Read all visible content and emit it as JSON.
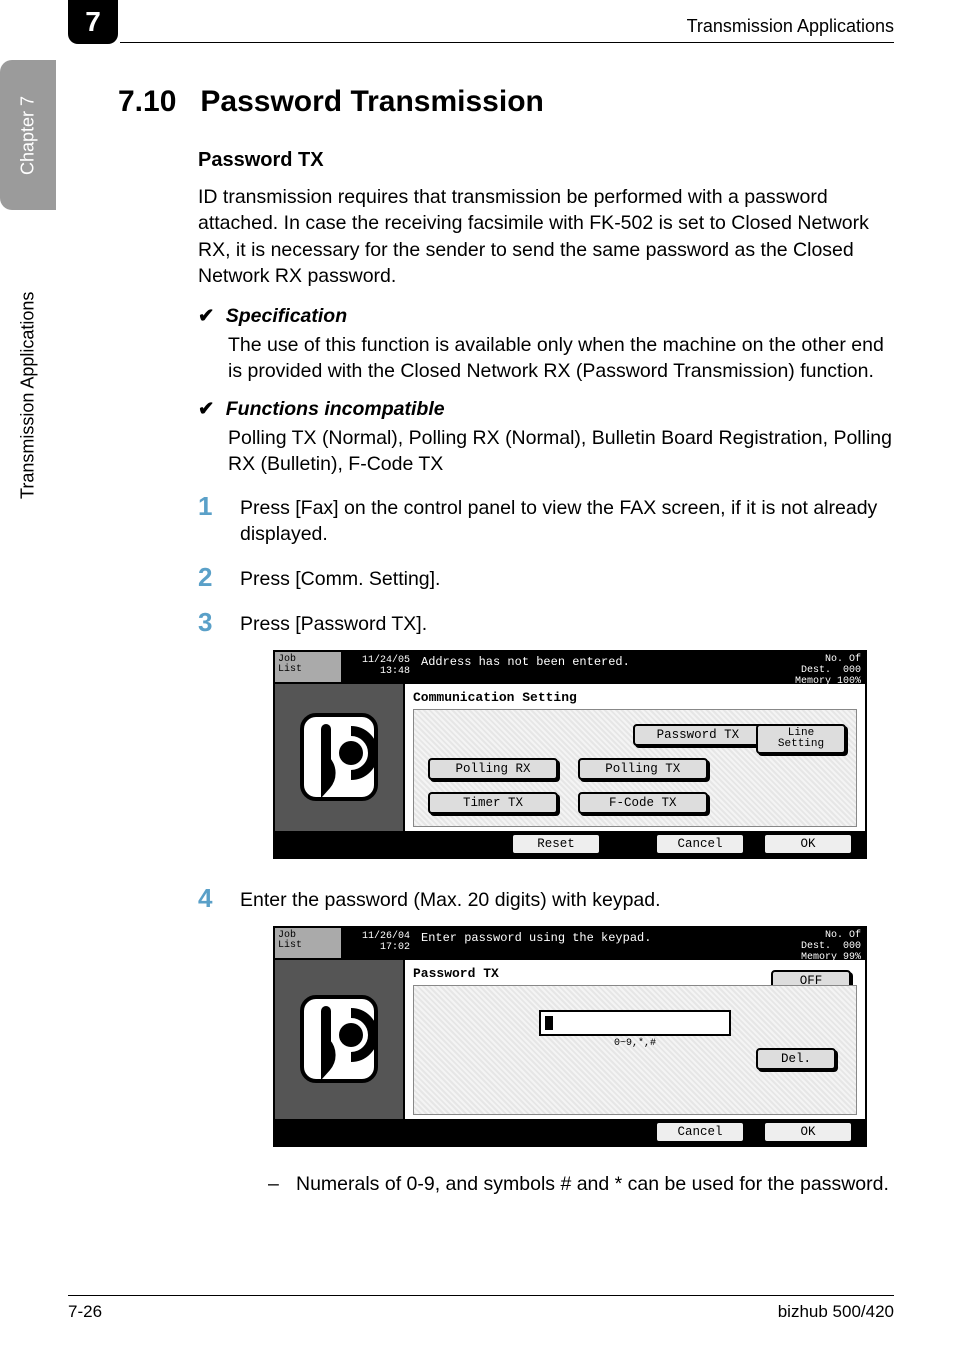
{
  "page": {
    "chapter_tab": "7",
    "side_chapter": "Chapter 7",
    "side_section": "Transmission Applications",
    "header_right": "Transmission Applications",
    "footer_left": "7-26",
    "footer_right": "bizhub 500/420"
  },
  "heading": {
    "number": "7.10",
    "title": "Password Transmission"
  },
  "subhead": "Password TX",
  "intro": "ID transmission requires that transmission be performed with a password attached. In case the receiving facsimile with FK-502 is set to Closed Network RX, it is necessary for the sender to send the same password as the Closed Network RX password.",
  "checks": [
    {
      "title": "Specification",
      "body": "The use of this function is available only when the machine on the other end is provided with the Closed Network RX (Password Transmission) function."
    },
    {
      "title": "Functions incompatible",
      "body": "Polling TX (Normal), Polling RX (Normal), Bulletin Board Registration, Polling RX (Bulletin), F-Code TX"
    }
  ],
  "steps": [
    {
      "n": "1",
      "text": "Press [Fax] on the control panel to view the FAX screen, if it is not already displayed."
    },
    {
      "n": "2",
      "text": "Press [Comm. Setting]."
    },
    {
      "n": "3",
      "text": "Press [Password TX]."
    },
    {
      "n": "4",
      "text": "Enter the password (Max. 20 digits) with keypad."
    }
  ],
  "note_after_4": "Numerals of 0-9, and symbols # and * can be used for the password.",
  "lcd1": {
    "joblist": "Job\nList",
    "datetime": "11/24/05\n13:48",
    "message": "Address has not been entered.",
    "dest_label": "No. Of\nDest.",
    "dest_count": "000",
    "memory": "Memory 100%",
    "heading": "Communication Setting",
    "buttons": {
      "password_tx": "Password TX",
      "line_setting": "Line\nSetting",
      "polling_rx": "Polling RX",
      "polling_tx": "Polling TX",
      "timer_tx": "Timer TX",
      "fcode_tx": "F-Code TX",
      "reset": "Reset",
      "cancel": "Cancel",
      "ok": "OK"
    }
  },
  "lcd2": {
    "joblist": "Job\nList",
    "datetime": "11/26/04\n17:02",
    "message": "Enter password using the keypad.",
    "dest_label": "No. Of\nDest.",
    "dest_count": "000",
    "memory": "Memory  99%",
    "heading": "Password TX",
    "hint": "0~9,*,#",
    "buttons": {
      "off": "OFF",
      "del": "Del.",
      "cancel": "Cancel",
      "ok": "OK"
    }
  }
}
